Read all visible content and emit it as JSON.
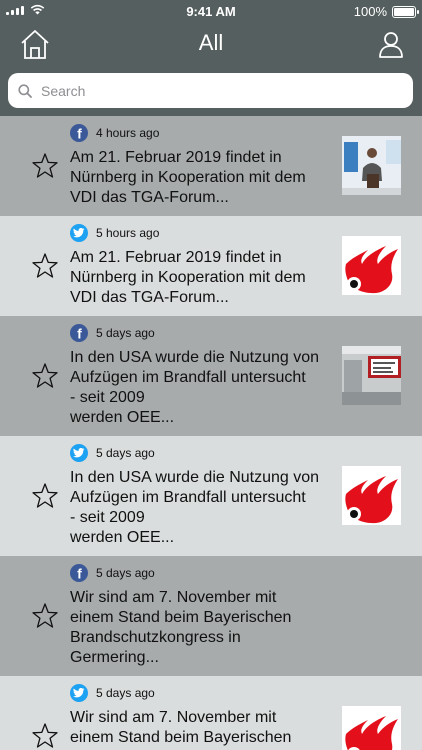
{
  "status_bar": {
    "time": "9:41 AM",
    "battery": "100%"
  },
  "nav": {
    "title": "All"
  },
  "search": {
    "placeholder": "Search"
  },
  "feed": [
    {
      "source": "facebook",
      "time": "4 hours ago",
      "lines": [
        "Am 21. Februar 2019 findet in",
        "Nürnberg in Kooperation mit dem",
        "VDI das TGA-Forum..."
      ],
      "thumbnail": "presenter-photo"
    },
    {
      "source": "twitter",
      "time": "5 hours ago",
      "lines": [
        "Am 21. Februar 2019 findet in",
        "Nürnberg in Kooperation mit dem",
        "VDI das TGA-Forum..."
      ],
      "thumbnail": "flame-logo"
    },
    {
      "source": "facebook",
      "time": "5 days ago",
      "lines": [
        "In den USA wurde die Nutzung von",
        "Aufzügen im Brandfall untersucht",
        "- seit 2009",
        "werden OEE..."
      ],
      "thumbnail": "elevator-photo"
    },
    {
      "source": "twitter",
      "time": "5 days ago",
      "lines": [
        "In den USA wurde die Nutzung von",
        "Aufzügen im Brandfall untersucht",
        "- seit 2009",
        "werden OEE..."
      ],
      "thumbnail": "flame-logo"
    },
    {
      "source": "facebook",
      "time": "5 days ago",
      "lines": [
        "Wir sind am 7. November mit",
        "einem Stand beim Bayerischen",
        "Brandschutzkongress in",
        "Germering..."
      ],
      "thumbnail": "none"
    },
    {
      "source": "twitter",
      "time": "5 days ago",
      "lines": [
        "Wir sind am 7. November mit",
        "einem Stand beim Bayerischen"
      ],
      "thumbnail": "flame-logo"
    }
  ]
}
